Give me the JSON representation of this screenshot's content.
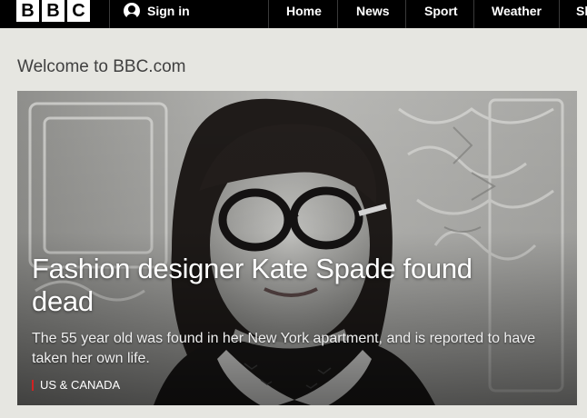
{
  "nav": {
    "logo_letters": [
      "B",
      "B",
      "C"
    ],
    "signin_label": "Sign in",
    "items": [
      "Home",
      "News",
      "Sport",
      "Weather",
      "Sh"
    ]
  },
  "page": {
    "welcome": "Welcome to BBC.com"
  },
  "hero": {
    "title": "Fashion designer Kate Spade found dead",
    "summary": "The 55 year old was found in her New York apartment, and is reported to have taken her own life.",
    "tag": "US & CANADA",
    "tag_color": "#d22222"
  }
}
